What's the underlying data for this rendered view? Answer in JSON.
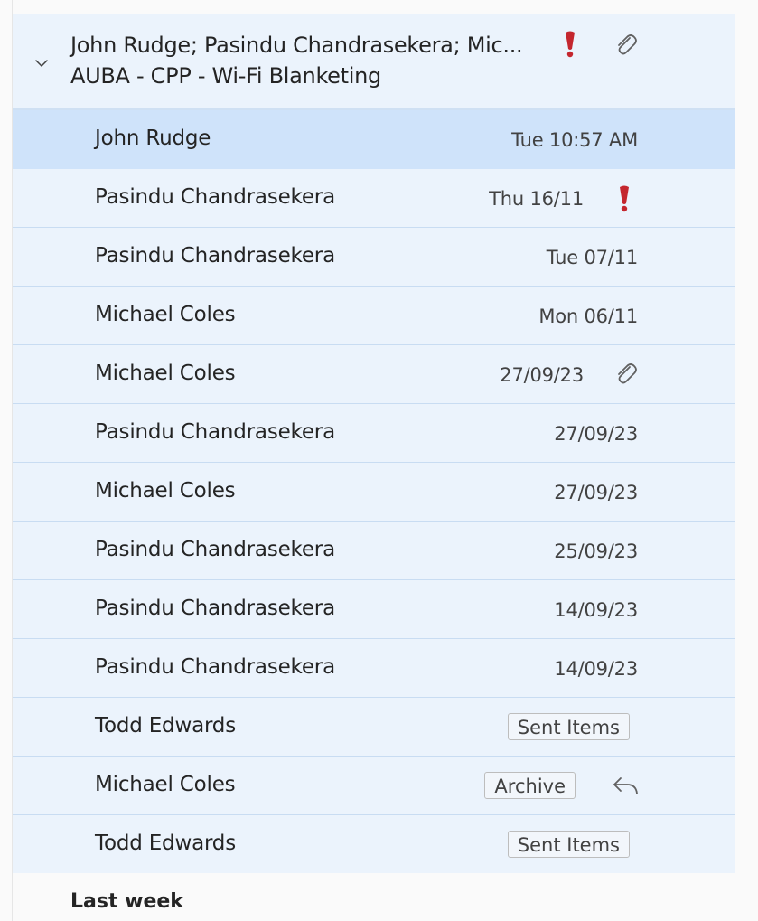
{
  "thread": {
    "participants": "John Rudge; Pasindu Chandrasekera; Mic...",
    "subject": "AUBA - CPP - Wi-Fi Blanketing",
    "icons": [
      "chevron-down-icon",
      "important-icon",
      "attachment-icon"
    ]
  },
  "messages": [
    {
      "sender": "John Rudge",
      "date": "Tue 10:57 AM"
    },
    {
      "sender": "Pasindu Chandrasekera",
      "date": "Thu 16/11",
      "icon": "important-icon"
    },
    {
      "sender": "Pasindu Chandrasekera",
      "date": "Tue 07/11"
    },
    {
      "sender": "Michael Coles",
      "date": "Mon 06/11"
    },
    {
      "sender": "Michael Coles",
      "date": "27/09/23",
      "icon": "attachment-icon"
    },
    {
      "sender": "Pasindu Chandrasekera",
      "date": "27/09/23"
    },
    {
      "sender": "Michael Coles",
      "date": "27/09/23"
    },
    {
      "sender": "Pasindu Chandrasekera",
      "date": "25/09/23"
    },
    {
      "sender": "Pasindu Chandrasekera",
      "date": "14/09/23"
    },
    {
      "sender": "Pasindu Chandrasekera",
      "date": "14/09/23"
    },
    {
      "sender": "Todd Edwards",
      "folder": "Sent Items"
    },
    {
      "sender": "Michael Coles",
      "folder": "Archive",
      "icon": "reply-icon"
    },
    {
      "sender": "Todd Edwards",
      "folder": "Sent Items"
    }
  ],
  "section": {
    "label": "Last week"
  },
  "colors": {
    "row_background": "#ebf3fc",
    "selected_background": "#cfe3fa",
    "important": "#c4262e"
  }
}
